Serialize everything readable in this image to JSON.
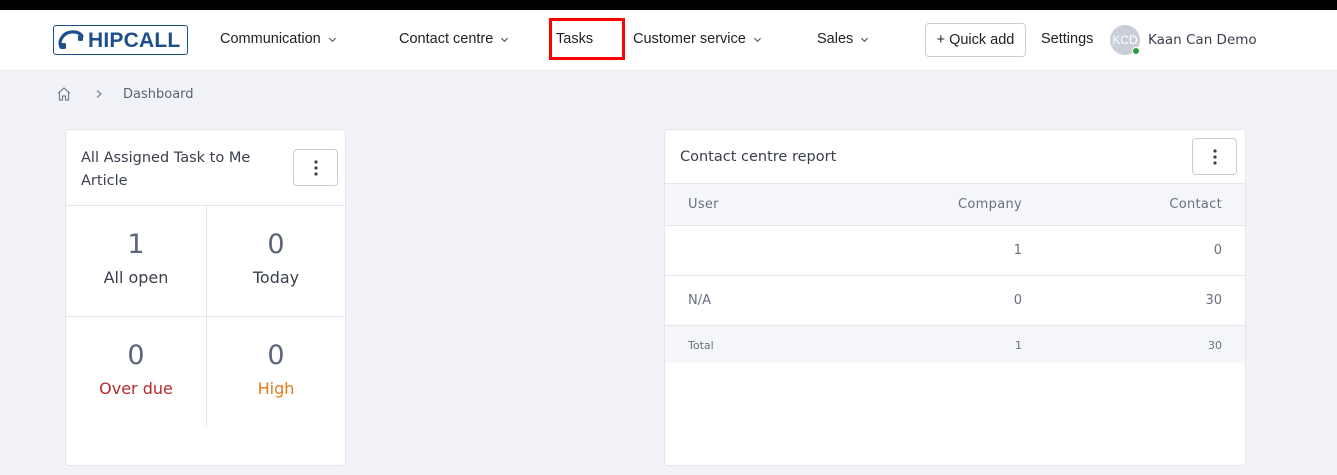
{
  "app": {
    "logo_text": "HIPCALL"
  },
  "nav": {
    "items": [
      {
        "label": "Communication"
      },
      {
        "label": "Contact centre"
      },
      {
        "label": "Tasks"
      },
      {
        "label": "Customer service"
      },
      {
        "label": "Sales"
      }
    ],
    "quick_add": "+ Quick add",
    "settings": "Settings",
    "user": {
      "initials": "KCD",
      "name": "Kaan Can Demo",
      "status_color": "#2d9c41"
    }
  },
  "breadcrumb": {
    "current": "Dashboard"
  },
  "tasks_card": {
    "title_line1": "All Assigned Task to Me",
    "title_line2": "Article",
    "stats": [
      {
        "value": "1",
        "label": "All open",
        "color": "#3a3f4c"
      },
      {
        "value": "0",
        "label": "Today",
        "color": "#3a3f4c"
      },
      {
        "value": "0",
        "label": "Over due",
        "color": "#b52a2a"
      },
      {
        "value": "0",
        "label": "High",
        "color": "#e07b17"
      }
    ]
  },
  "report_card": {
    "title": "Contact centre report",
    "columns": {
      "user": "User",
      "company": "Company",
      "contact": "Contact"
    },
    "rows": [
      {
        "user": "",
        "company": "1",
        "contact": "0"
      },
      {
        "user": "N/A",
        "company": "0",
        "contact": "30"
      }
    ],
    "total": {
      "user": "Total",
      "company": "1",
      "contact": "30"
    }
  },
  "colors": {
    "brand": "#1d4f8c",
    "highlight": "#ff0000"
  }
}
